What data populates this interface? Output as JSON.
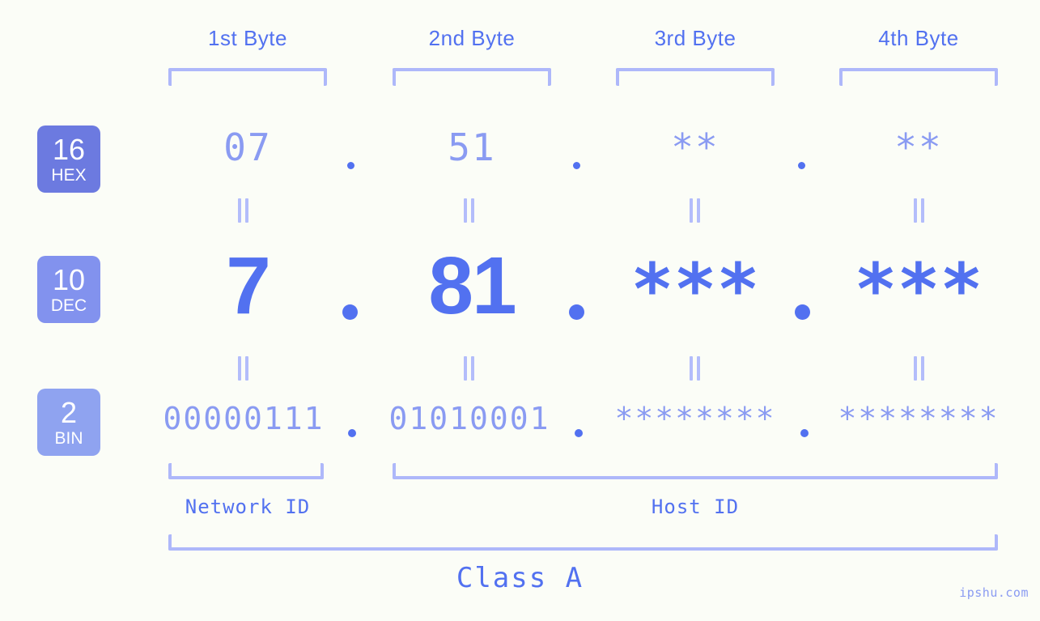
{
  "header": {
    "byte_labels": [
      "1st Byte",
      "2nd Byte",
      "3rd Byte",
      "4th Byte"
    ]
  },
  "bases": [
    {
      "num": "16",
      "name": "HEX",
      "color": "#6c7ae0"
    },
    {
      "num": "10",
      "name": "DEC",
      "color": "#8292ee"
    },
    {
      "num": "2",
      "name": "BIN",
      "color": "#8fa3f0"
    }
  ],
  "rows": {
    "hex": {
      "base": "16",
      "values": [
        "07",
        "51",
        "**",
        "**"
      ]
    },
    "dec": {
      "base": "10",
      "values": [
        "7",
        "81",
        "***",
        "***"
      ]
    },
    "bin": {
      "base": "2",
      "values": [
        "00000111",
        "01010001",
        "********",
        "********"
      ]
    }
  },
  "separator": ".",
  "footer": {
    "network_id": "Network ID",
    "host_id": "Host ID",
    "class": "Class A",
    "watermark": "ipshu.com"
  },
  "colors": {
    "background": "#fbfdf7",
    "accent_strong": "#5271f0",
    "accent_light": "#8a9bf2",
    "bracket": "#aeb8fa"
  }
}
